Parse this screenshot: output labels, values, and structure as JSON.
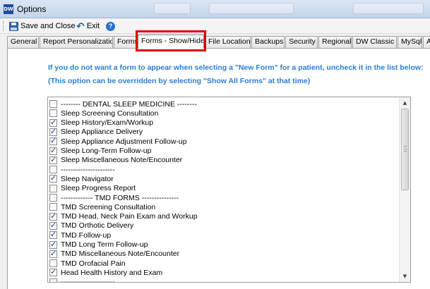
{
  "window": {
    "title": "Options",
    "app_icon_text": "DW"
  },
  "toolbar": {
    "save_close_label": "Save and Close",
    "exit_label": "Exit",
    "help_glyph": "?",
    "icons": {
      "save": "save-icon",
      "exit": "undo-arrow-icon",
      "help": "help-icon"
    }
  },
  "tabs": [
    {
      "label": "General",
      "active": false
    },
    {
      "label": "Report Personalization",
      "active": false
    },
    {
      "label": "Forms",
      "active": false
    },
    {
      "label": "Forms - Show/Hide",
      "active": true
    },
    {
      "label": "File Locations",
      "active": false
    },
    {
      "label": "Backups",
      "active": false
    },
    {
      "label": "Security",
      "active": false
    },
    {
      "label": "Regional",
      "active": false
    },
    {
      "label": "DW Classic",
      "active": false
    },
    {
      "label": "MySql",
      "active": false
    },
    {
      "label": "Ap",
      "active": false
    }
  ],
  "highlight_color": "#e10000",
  "instructions": {
    "line1": "If you do not want a form to appear when selecting a \"New Form\" for a patient, uncheck it in the list below:",
    "line2": "(This option can be overridden by selecting \"Show All Forms\" at that time)",
    "color": "#2a7ed6"
  },
  "form_list": [
    {
      "label": "-------- DENTAL SLEEP MEDICINE --------",
      "checked": false
    },
    {
      "label": "Sleep Screening Consultation",
      "checked": false
    },
    {
      "label": "Sleep History/Exam/Workup",
      "checked": true
    },
    {
      "label": "Sleep Appliance Delivery",
      "checked": true
    },
    {
      "label": "Sleep Appliance Adjustment Follow-up",
      "checked": true
    },
    {
      "label": "Sleep Long-Term Follow-up",
      "checked": true
    },
    {
      "label": "Sleep Miscellaneous Note/Encounter",
      "checked": true
    },
    {
      "label": "----------------------",
      "checked": false
    },
    {
      "label": "Sleep Navigator",
      "checked": true
    },
    {
      "label": "Sleep Progress Report",
      "checked": false
    },
    {
      "label": "------------- TMD FORMS ---------------",
      "checked": false
    },
    {
      "label": "TMD Screening Consultation",
      "checked": false
    },
    {
      "label": "TMD Head, Neck Pain Exam and Workup",
      "checked": true
    },
    {
      "label": "TMD Orthotic Delivery",
      "checked": true
    },
    {
      "label": "TMD Follow-up",
      "checked": true
    },
    {
      "label": "TMD Long Term Follow-up",
      "checked": true
    },
    {
      "label": "TMD Miscellaneous Note/Encounter",
      "checked": true
    },
    {
      "label": "TMD Orofacial Pain",
      "checked": false
    },
    {
      "label": "Head Health History and Exam",
      "checked": true
    },
    {
      "label": "----------------------",
      "checked": false
    }
  ]
}
